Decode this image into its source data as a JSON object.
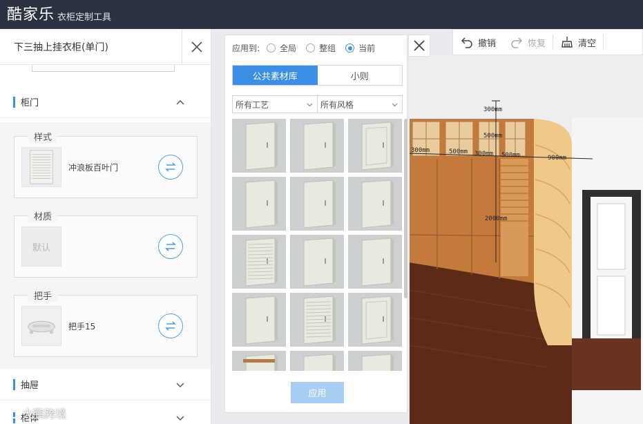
{
  "app": {
    "logo": "酷家乐",
    "subtitle": "衣柜定制工具"
  },
  "panel": {
    "title": "下三抽上挂衣柜(单门)",
    "sections": {
      "door": "柜门",
      "drawer": "抽屉",
      "cabinet": "柜体"
    },
    "cards": [
      {
        "legend": "样式",
        "value": "冲浪板百叶门",
        "thumb_icon": "louver-door-thumb"
      },
      {
        "legend": "材质",
        "value": "默认",
        "thumb_icon": "default-material-thumb"
      },
      {
        "legend": "把手",
        "value": "把手15",
        "thumb_icon": "handle-thumb"
      }
    ]
  },
  "picker": {
    "apply_to_label": "应用到:",
    "apply_options": [
      {
        "label": "全局",
        "checked": false
      },
      {
        "label": "整组",
        "checked": false
      },
      {
        "label": "当前",
        "checked": true
      }
    ],
    "tabs": [
      {
        "label": "公共素材库",
        "active": true
      },
      {
        "label": "小则",
        "active": false
      }
    ],
    "filters": [
      {
        "value": "所有工艺"
      },
      {
        "value": "所有风格"
      }
    ],
    "tiles": [
      "plain",
      "plain",
      "inset",
      "plain",
      "plain",
      "plain",
      "louver",
      "plain",
      "plain",
      "plain",
      "louver",
      "inset",
      "handle-bar",
      "plain",
      "plain"
    ],
    "apply_button": "应用"
  },
  "toolbar": {
    "undo": "撤销",
    "redo": "恢复",
    "clear": "清空"
  },
  "scene": {
    "dimensions": [
      "300mm",
      "500mm",
      "300mm",
      "500mm",
      "300mm",
      "500mm",
      "900mm",
      "2000mm"
    ]
  },
  "watermark": {
    "text": "大鹏跨境"
  },
  "colors": {
    "accent": "#3b8ee6",
    "topbar": "#2b3240",
    "apply_disabled": "#a7cef3"
  }
}
